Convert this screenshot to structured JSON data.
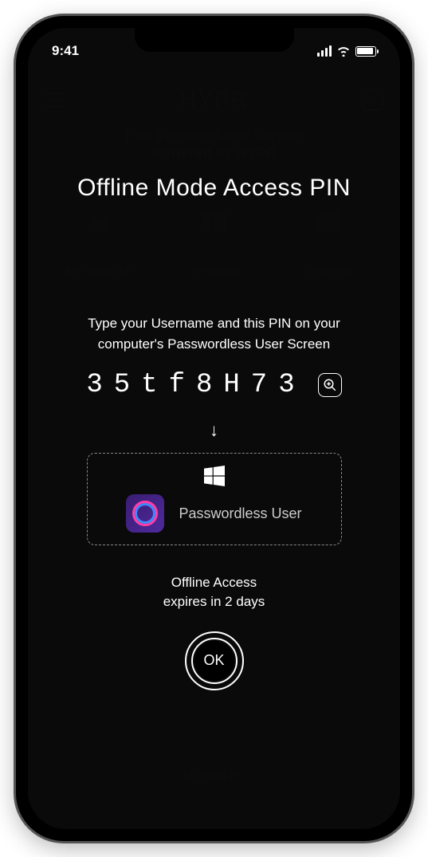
{
  "status_bar": {
    "time": "9:41"
  },
  "background": {
    "logo": "HYPR",
    "tagline_line1": "True Password-less Security",
    "tagline_line2": "Powered by HYPR",
    "devices": [
      {
        "name": "My Home Mac",
        "os": "apple"
      },
      {
        "name": "Conference",
        "os": "windows"
      },
      {
        "name": "Conference",
        "os": "windows"
      }
    ],
    "bottom_device": "My Work PC"
  },
  "overlay": {
    "title": "Offline Mode Access PIN",
    "instruction": "Type your Username and this PIN on your computer's Passwordless User Screen",
    "pin": "35tf8H73",
    "target_user": "Passwordless User",
    "expiry_line1": "Offline Access",
    "expiry_line2": "expires in 2 days",
    "ok_label": "OK"
  }
}
